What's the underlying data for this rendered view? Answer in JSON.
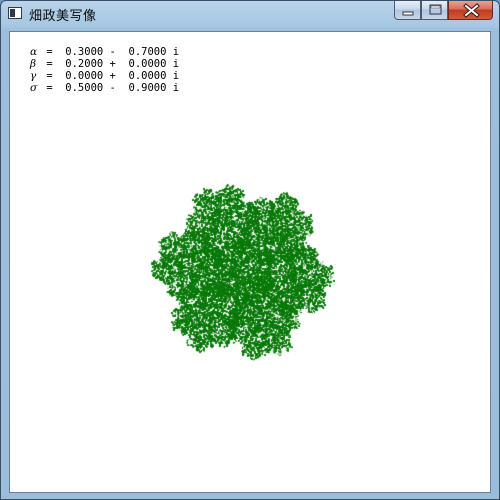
{
  "window": {
    "title": "畑政美写像"
  },
  "colors": {
    "fractal": "#0a7a0a",
    "client_bg": "#ffffff"
  },
  "params": [
    {
      "symbol": "α",
      "text": " =  0.3000 -  0.7000 i"
    },
    {
      "symbol": "β",
      "text": " =  0.2000 +  0.0000 i"
    },
    {
      "symbol": "γ",
      "text": " =  0.0000 +  0.0000 i"
    },
    {
      "symbol": "σ",
      "text": " =  0.5000 -  0.9000 i"
    }
  ],
  "icons": {
    "app": "app-window-icon",
    "minimize": "minimize-icon",
    "maximize": "maximize-icon",
    "close": "close-icon"
  }
}
